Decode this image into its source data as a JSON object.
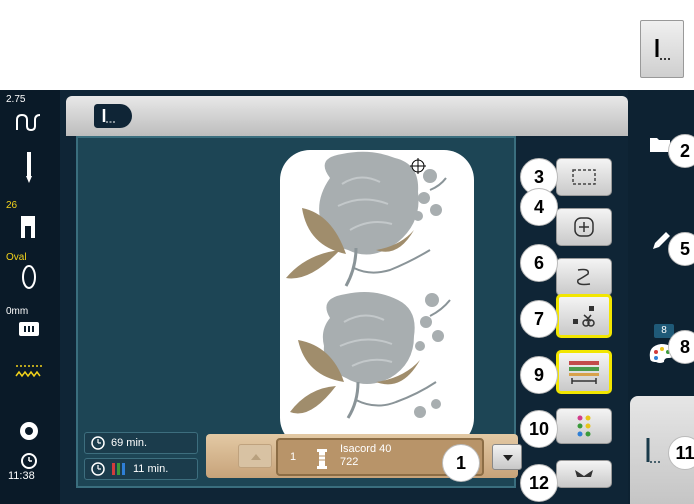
{
  "status_bar": {
    "stitch_length": "2.75",
    "needle_position": "26",
    "hoop_name": "Oval",
    "offset": "0mm",
    "clock": "11:38"
  },
  "callouts": [
    "1",
    "2",
    "3",
    "4",
    "5",
    "6",
    "7",
    "8",
    "9",
    "10",
    "11",
    "12"
  ],
  "thread": {
    "index": "1",
    "name": "Isacord 40",
    "code": "722"
  },
  "times": {
    "total": "69 min.",
    "color": "11 min."
  },
  "color_badge": "8",
  "colors": {
    "screen_bg": "#0f2536",
    "workspace": "#1d4555",
    "rose_gray": "#a8aeb0",
    "leaf_tan": "#a08d6c",
    "highlight": "#f2e600",
    "bottom_bar": "#c9a57b"
  }
}
